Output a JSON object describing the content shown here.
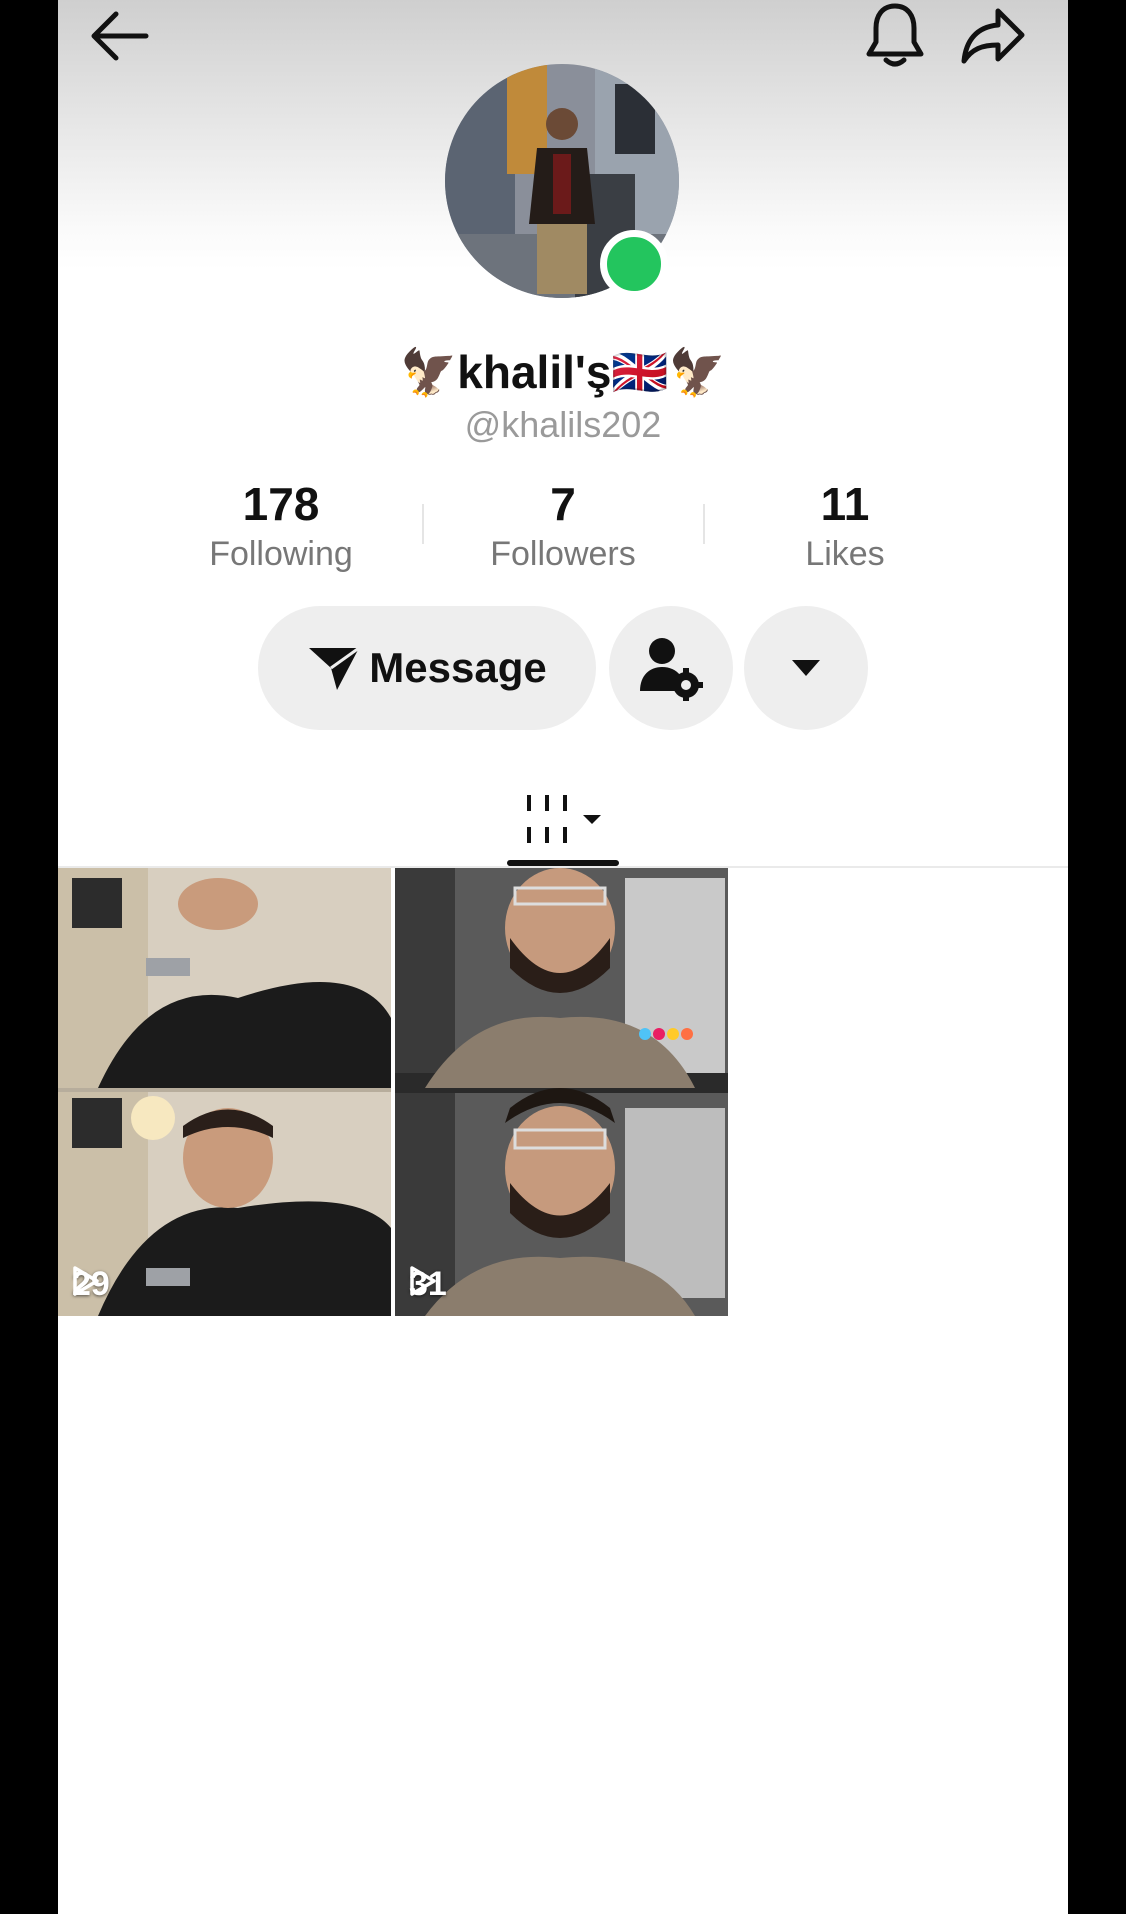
{
  "header": {
    "back_icon": "back-arrow-icon",
    "bell_icon": "bell-icon",
    "share_icon": "share-icon"
  },
  "profile": {
    "display_name": "🦅khalil'ş🇬🇧🦅",
    "username": "@khalils202",
    "online_color": "#23c55e"
  },
  "stats": [
    {
      "value": "178",
      "label": "Following"
    },
    {
      "value": "7",
      "label": "Followers"
    },
    {
      "value": "11",
      "label": "Likes"
    }
  ],
  "actions": {
    "message_label": "Message",
    "message_icon": "send-icon",
    "friend_icon": "user-settings-icon",
    "more_icon": "caret-down-icon"
  },
  "tabs": {
    "videos_icon": "grid-icon"
  },
  "videos": [
    {
      "views": "29"
    },
    {
      "views": "31"
    }
  ]
}
